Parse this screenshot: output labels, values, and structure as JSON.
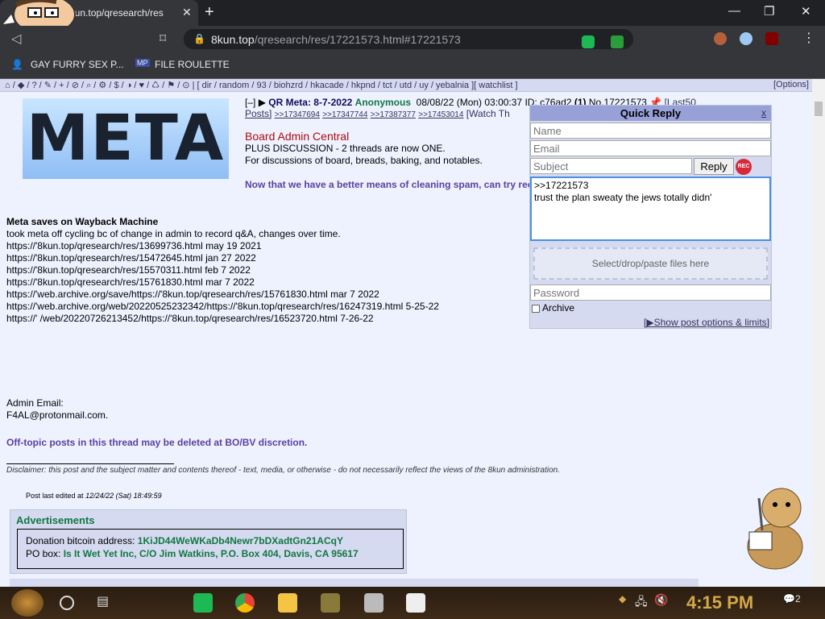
{
  "browser": {
    "tab_title": "8kun.top/qresearch/res",
    "url_domain": "8kun.top",
    "url_path": "/qresearch/res/17221573.html#17221573",
    "bookmarks": [
      "GAY FURRY SEX P...",
      "FILE ROULETTE"
    ]
  },
  "boardlist": {
    "links": "[ dir / random / 93 / biohzrd / hkacade / hkpnd / tct / utd / uy / yebalnia ][ watchlist ]",
    "options": "[Options]"
  },
  "banner": {
    "text": "META"
  },
  "post": {
    "toggle": "[–]",
    "subject": "QR Meta: 8-7-2022",
    "name": "Anonymous",
    "date": "08/08/22 (Mon) 03:00:37",
    "id": "ID: c76ad2",
    "count": "(1)",
    "no": "No.17221573",
    "last50": "[Last50",
    "posts": "Posts]",
    "backlinks": [
      ">>17347694",
      ">>17347744",
      ">>17387377",
      ">>17453014"
    ],
    "watch": "[Watch Th",
    "heading": "Board Admin Central",
    "line1": "PLUS DISCUSSION - 2 threads are now ONE.",
    "line2": "For discussions of board, breads, baking, and notables.",
    "purple_line": "Now that we have a better means of cleaning spam, can try rec",
    "wayback_title": "Meta saves on Wayback Machine",
    "wayback_lines": [
      "took meta off cycling bc of change in admin to record q&A, changes over time.",
      "https://'8kun.top/qresearch/res/13699736.html  may 19 2021",
      "https://'8kun.top/qresearch/res/15472645.html  jan 27 2022",
      "https://'8kun.top/qresearch/res/15570311.html feb 7 2022",
      "https://'8kun.top/qresearch/res/15761830.html mar 7 2022",
      "https://'web.archive.org/save/https://'8kun.top/qresearch/res/15761830.html mar 7 2022",
      "https://'web.archive.org/web/20220525232342/https://'8kun.top/qresearch/res/16247319.html 5-25-22",
      "https://' /web/20220726213452/https://'8kun.top/qresearch/res/16523720.html  7-26-22"
    ],
    "admin_email_label": "Admin Email:",
    "admin_email": "F4AL@protonmail.com.",
    "offtopic": "Off-topic posts in this thread may be deleted at BO/BV discretion.",
    "disclaimer": "Disclaimer: this post and the subject matter and contents thereof - text, media, or otherwise - do not necessarily reflect the views of the 8kun administration.",
    "edited_label": "Post last edited at",
    "edited_date": "12/24/22 (Sat) 18:49:59"
  },
  "ads": {
    "title": "Advertisements",
    "bitcoin_label": "Donation bitcoin address:",
    "bitcoin": "1KiJD44WeWKaDb4Newr7bDXadtGn21ACqY",
    "po_label": "PO box:",
    "po": "Is It Wet Yet Inc, C/O Jim Watkins, P.O. Box 404, Davis, CA 95617"
  },
  "quick_reply": {
    "title": "Quick Reply",
    "close": "x",
    "name_ph": "Name",
    "email_ph": "Email",
    "subject_ph": "Subject",
    "reply": "Reply",
    "rec": "REC",
    "text": ">>17221573\ntrust the plan sweaty the jews totally didn'",
    "drop": "Select/drop/paste files here",
    "password_ph": "Password",
    "archive": "Archive",
    "show_opts": "[▶Show post options & limits]"
  },
  "taskbar": {
    "clock": "4:15 PM",
    "notif_count": "2"
  },
  "colors": {
    "accent": "#117743",
    "subject": "#0f0c5d",
    "heading": "#af0a0f"
  }
}
